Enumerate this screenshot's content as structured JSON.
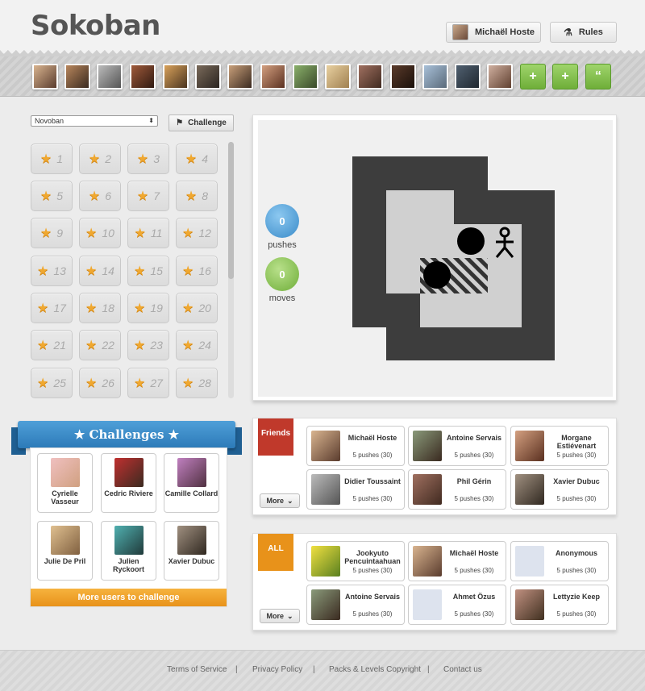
{
  "app": {
    "title": "Sokoban"
  },
  "header": {
    "user_name": "Michaël Hoste",
    "rules_label": "Rules"
  },
  "friendbar": {
    "avatar_count": 15
  },
  "level_select": {
    "pack": "Novoban",
    "challenge_label": "Challenge",
    "levels": [
      "1",
      "2",
      "3",
      "4",
      "5",
      "6",
      "7",
      "8",
      "9",
      "10",
      "11",
      "12",
      "13",
      "14",
      "15",
      "16",
      "17",
      "18",
      "19",
      "20",
      "21",
      "22",
      "23",
      "24",
      "25",
      "26",
      "27",
      "28"
    ]
  },
  "game": {
    "pushes_value": "0",
    "pushes_label": "pushes",
    "moves_value": "0",
    "moves_label": "moves"
  },
  "challenges": {
    "title": "★ Challenges ★",
    "users": [
      {
        "name": "Cyrielle Vasseur"
      },
      {
        "name": "Cedric Riviere"
      },
      {
        "name": "Camille Collard"
      },
      {
        "name": "Julie De Pril"
      },
      {
        "name": "Julien Ryckoort"
      },
      {
        "name": "Xavier Dubuc"
      }
    ],
    "more_label": "More users to challenge"
  },
  "friends_scores": {
    "flag": "Friends",
    "more_label": "More",
    "entries": [
      {
        "name": "Michaël Hoste",
        "score": "5 pushes (30)"
      },
      {
        "name": "Antoine Servais",
        "score": "5 pushes (30)"
      },
      {
        "name": "Morgane Estiévenart",
        "score": "5 pushes (30)"
      },
      {
        "name": "Didier Toussaint",
        "score": "5 pushes (30)"
      },
      {
        "name": "Phil Gérin",
        "score": "5 pushes (30)"
      },
      {
        "name": "Xavier Dubuc",
        "score": "5 pushes (30)"
      }
    ]
  },
  "all_scores": {
    "flag": "ALL",
    "more_label": "More",
    "entries": [
      {
        "name": "Jookyuto Pencuintaahuan",
        "score": "5 pushes (30)"
      },
      {
        "name": "Michaël Hoste",
        "score": "5 pushes (30)"
      },
      {
        "name": "Anonymous",
        "score": "5 pushes (30)"
      },
      {
        "name": "Antoine Servais",
        "score": "5 pushes (30)"
      },
      {
        "name": "Ahmet Özus",
        "score": "5 pushes (30)"
      },
      {
        "name": "Lettyzie Keep",
        "score": "5 pushes (30)"
      }
    ]
  },
  "footer": {
    "links": [
      "Terms of Service",
      "Privacy Policy",
      "Packs & Levels Copyright",
      "Contact us"
    ],
    "separator": "|"
  },
  "colors": {
    "accent_blue": "#3a8bc9",
    "accent_green": "#7cbf43",
    "accent_orange": "#f0a030",
    "flag_red": "#c0392b",
    "wall": "#3d3d3d"
  }
}
